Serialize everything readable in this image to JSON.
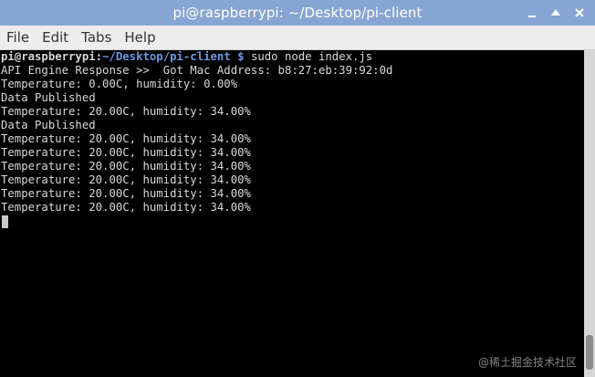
{
  "window": {
    "title": "pi@raspberrypi: ~/Desktop/pi-client",
    "buttons": [
      {
        "icon": "minimize-icon"
      },
      {
        "icon": "maximize-icon"
      },
      {
        "icon": "close-icon"
      }
    ]
  },
  "menu": {
    "items": [
      "File",
      "Edit",
      "Tabs",
      "Help"
    ]
  },
  "terminal": {
    "prompt_user": "pi@raspberrypi",
    "prompt_sep": ":",
    "prompt_path": "~/Desktop/pi-client $",
    "command": " sudo node index.js",
    "output": [
      "API Engine Response >>  Got Mac Address: b8:27:eb:39:92:0d",
      "Temperature: 0.00C, humidity: 0.00%",
      "Data Published",
      "Temperature: 20.00C, humidity: 34.00%",
      "Data Published",
      "Temperature: 20.00C, humidity: 34.00%",
      "Temperature: 20.00C, humidity: 34.00%",
      "Temperature: 20.00C, humidity: 34.00%",
      "Temperature: 20.00C, humidity: 34.00%",
      "Temperature: 20.00C, humidity: 34.00%",
      "Temperature: 20.00C, humidity: 34.00%"
    ]
  },
  "watermark": "@稀土掘金技术社区",
  "colors": {
    "titlebar": "#87a5d2",
    "terminal_bg": "#000000",
    "terminal_fg": "#d8d8d8",
    "prompt_path": "#6a9be0"
  }
}
